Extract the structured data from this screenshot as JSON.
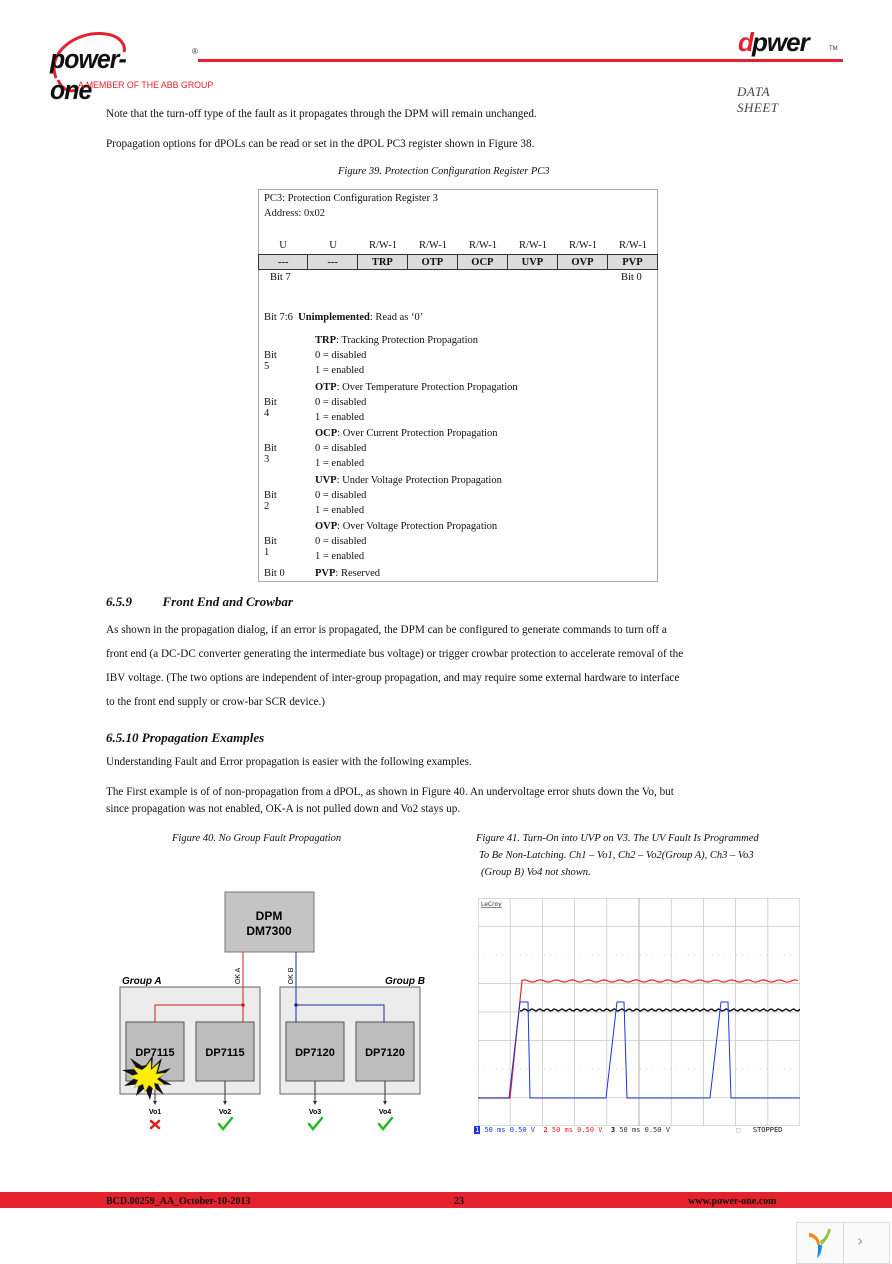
{
  "header": {
    "logo_text": "power-one",
    "logo_registered": "®",
    "logo_tagline": "A MEMBER OF THE ABB GROUP",
    "brand_d": "d",
    "brand_rest": "pwer",
    "brand_tm": "TM",
    "doc_type": "DATA SHEET"
  },
  "intro": {
    "p1": "Note that the turn-off type of the fault as it propagates through the DPM will remain unchanged.",
    "p2": "Propagation options for dPOLs can be read or set in the dPOL PC3 register shown in Figure 38."
  },
  "figure39": {
    "caption": "Figure 39. Protection Configuration Register PC3",
    "title": "PC3: Protection Configuration Register 3",
    "address": "Address: 0x02",
    "access": [
      "U",
      "U",
      "R/W-1",
      "R/W-1",
      "R/W-1",
      "R/W-1",
      "R/W-1",
      "R/W-1"
    ],
    "fields": [
      "---",
      "---",
      "TRP",
      "OTP",
      "OCP",
      "UVP",
      "OVP",
      "PVP"
    ],
    "bit_high": "Bit 7",
    "bit_low": "Bit 0",
    "unimpl_bits": "Bit 7:6",
    "unimpl_name": "Unimplemented",
    "unimpl_desc": ": Read as ‘0’",
    "bits": [
      {
        "bit": "Bit 5",
        "name": "TRP",
        "desc": ": Tracking Protection Propagation",
        "v0": "0 = disabled",
        "v1": "1 = enabled"
      },
      {
        "bit": "Bit 4",
        "name": "OTP",
        "desc": ": Over Temperature Protection Propagation",
        "v0": "0 = disabled",
        "v1": "1 = enabled"
      },
      {
        "bit": "Bit 3",
        "name": "OCP",
        "desc": ": Over Current Protection Propagation",
        "v0": "0 = disabled",
        "v1": "1 = enabled"
      },
      {
        "bit": "Bit 2",
        "name": "UVP",
        "desc": ": Under Voltage Protection Propagation",
        "v0": "0 = disabled",
        "v1": "1 = enabled"
      },
      {
        "bit": "Bit 1",
        "name": "OVP",
        "desc": ": Over Voltage Protection Propagation",
        "v0": "0 = disabled",
        "v1": "1 = enabled"
      }
    ],
    "bit0": {
      "bit": "Bit 0",
      "name": "PVP",
      "desc": ": Reserved"
    }
  },
  "section659": {
    "number": "6.5.9",
    "title": "Front End and Crowbar",
    "lines": [
      "As shown in the propagation dialog, if an error is propagated, the DPM can be configured to generate commands to turn off a",
      "front end (a DC-DC converter generating the intermediate bus voltage) or trigger crowbar protection to accelerate removal of the",
      "IBV voltage. (The two options are independent of inter-group propagation, and may require some external hardware to interface",
      "to the front end supply or crow-bar SCR device.)"
    ]
  },
  "section6510": {
    "number": "6.5.10",
    "title": "Propagation Examples",
    "p1": "Understanding Fault and Error propagation is easier with the following examples.",
    "p2_lines": [
      "The First example is of of non-propagation from a dPOL, as shown in Figure 40. An undervoltage error shuts down the Vo, but",
      "since propagation was not enabled, OK-A is not pulled down and Vo2 stays up."
    ]
  },
  "figure40": {
    "caption": "Figure 40. No Group Fault Propagation",
    "dpm_line1": "DPM",
    "dpm_line2": "DM7300",
    "ok_a": "OK A",
    "ok_b": "OK B",
    "group_a": "Group A",
    "group_b": "Group B",
    "pols": [
      {
        "label": "DP7115",
        "output": "Vo1",
        "status": "fail"
      },
      {
        "label": "DP7115",
        "output": "Vo2",
        "status": "ok"
      },
      {
        "label": "DP7120",
        "output": "Vo3",
        "status": "ok"
      },
      {
        "label": "DP7120",
        "output": "Vo4",
        "status": "ok"
      }
    ],
    "colors": {
      "group_a_line": "#cc1f1f",
      "group_b_line": "#1a2a9c",
      "ok": "#22bb22",
      "fail": "#dd2222"
    }
  },
  "figure41": {
    "caption_lines": [
      "Figure 41. Turn-On into UVP on V3. The UV Fault Is Programmed",
      "To Be Non-Latching. Ch1 – Vo1,  Ch2 – Vo2(Group A), Ch3 – Vo3",
      "(Group B) Vo4 not shown."
    ],
    "brand": "LeCroy",
    "channels": [
      {
        "num": "1",
        "label": "50 ms 0.50 V",
        "color": "#2233dd"
      },
      {
        "num": "2",
        "label": "50 ms 0.50 V",
        "color": "#ee2222"
      },
      {
        "num": "3",
        "label": "50 ms 0.50 V",
        "color": "#111111"
      }
    ],
    "status": "STOPPED"
  },
  "footer": {
    "doc_id": "BCD.00259_AA_October-10-2013",
    "page": "23",
    "url": "www.power-one.com"
  },
  "widget": {
    "next_glyph": "›"
  }
}
